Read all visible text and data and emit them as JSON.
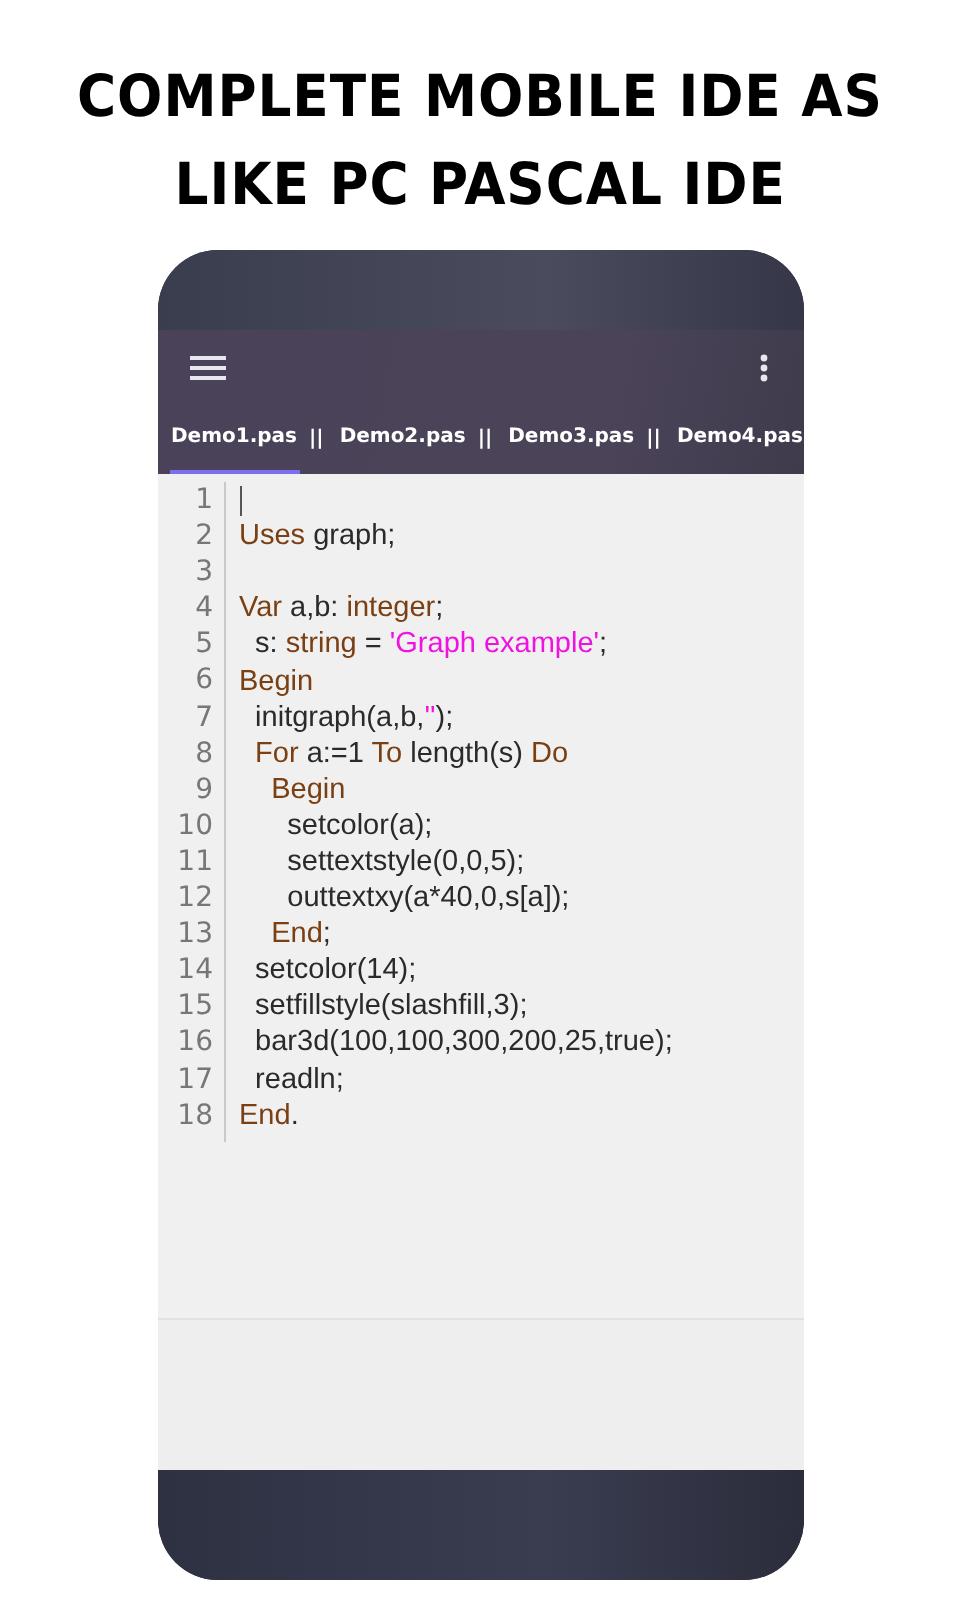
{
  "headline": [
    "COMPLETE MOBILE IDE AS",
    "LIKE PC PASCAL IDE"
  ],
  "tabs": [
    {
      "label": "Demo1.pas",
      "selected": true,
      "separator": "||"
    },
    {
      "label": "Demo2.pas",
      "selected": false,
      "separator": "||"
    },
    {
      "label": "Demo3.pas",
      "selected": false,
      "separator": "||"
    },
    {
      "label": "Demo4.pas",
      "selected": false
    }
  ],
  "editor": {
    "lines": [
      {
        "number": "1",
        "cursor": true
      },
      {
        "number": "2",
        "tokens": [
          {
            "kind": "kw",
            "text": "Uses"
          },
          {
            "kind": "text",
            "text": " graph;"
          }
        ]
      },
      {
        "number": "3"
      },
      {
        "number": "4",
        "tokens": [
          {
            "kind": "kw",
            "text": "Var"
          },
          {
            "kind": "text",
            "text": " a,b: "
          },
          {
            "kind": "kw",
            "text": "integer"
          },
          {
            "kind": "text",
            "text": ";"
          }
        ]
      },
      {
        "number": "5",
        "tokens": [
          {
            "kind": "text",
            "text": "  s: "
          },
          {
            "kind": "kw",
            "text": "string"
          },
          {
            "kind": "text",
            "text": " = "
          },
          {
            "kind": "str",
            "text": "'Graph example'"
          },
          {
            "kind": "text",
            "text": ";"
          }
        ]
      },
      {
        "number": "6",
        "tokens": [
          {
            "kind": "kw",
            "text": "Begin"
          }
        ]
      },
      {
        "number": "7",
        "tokens": [
          {
            "kind": "text",
            "text": "  initgraph(a,b,"
          },
          {
            "kind": "str",
            "text": "''"
          },
          {
            "kind": "text",
            "text": ");"
          }
        ]
      },
      {
        "number": "8",
        "tokens": [
          {
            "kind": "kw",
            "text": "  For"
          },
          {
            "kind": "text",
            "text": " a:=1 "
          },
          {
            "kind": "kw",
            "text": "To"
          },
          {
            "kind": "text",
            "text": " length(s) "
          },
          {
            "kind": "kw",
            "text": "Do"
          }
        ]
      },
      {
        "number": "9",
        "tokens": [
          {
            "kind": "kw",
            "text": "    Begin"
          }
        ]
      },
      {
        "number": "10",
        "tokens": [
          {
            "kind": "text",
            "text": "      setcolor(a);"
          }
        ]
      },
      {
        "number": "11",
        "tokens": [
          {
            "kind": "text",
            "text": "      settextstyle(0,0,5);"
          }
        ]
      },
      {
        "number": "12",
        "tokens": [
          {
            "kind": "text",
            "text": "      outtextxy(a*40,0,s[a]);"
          }
        ]
      },
      {
        "number": "13",
        "tokens": [
          {
            "kind": "kw",
            "text": "    End"
          },
          {
            "kind": "text",
            "text": ";"
          }
        ]
      },
      {
        "number": "14",
        "tokens": [
          {
            "kind": "text",
            "text": "  setcolor(14);"
          }
        ]
      },
      {
        "number": "15",
        "tokens": [
          {
            "kind": "text",
            "text": "  setfillstyle(slashfill,3);"
          }
        ]
      },
      {
        "number": "16",
        "tokens": [
          {
            "kind": "text",
            "text": "  bar3d(100,100,300,200,25,true);"
          }
        ]
      },
      {
        "number": "17",
        "tokens": [
          {
            "kind": "text",
            "text": "  readln;"
          }
        ]
      },
      {
        "number": "18",
        "tokens": [
          {
            "kind": "kw",
            "text": "End"
          },
          {
            "kind": "text",
            "text": "."
          }
        ]
      }
    ]
  }
}
